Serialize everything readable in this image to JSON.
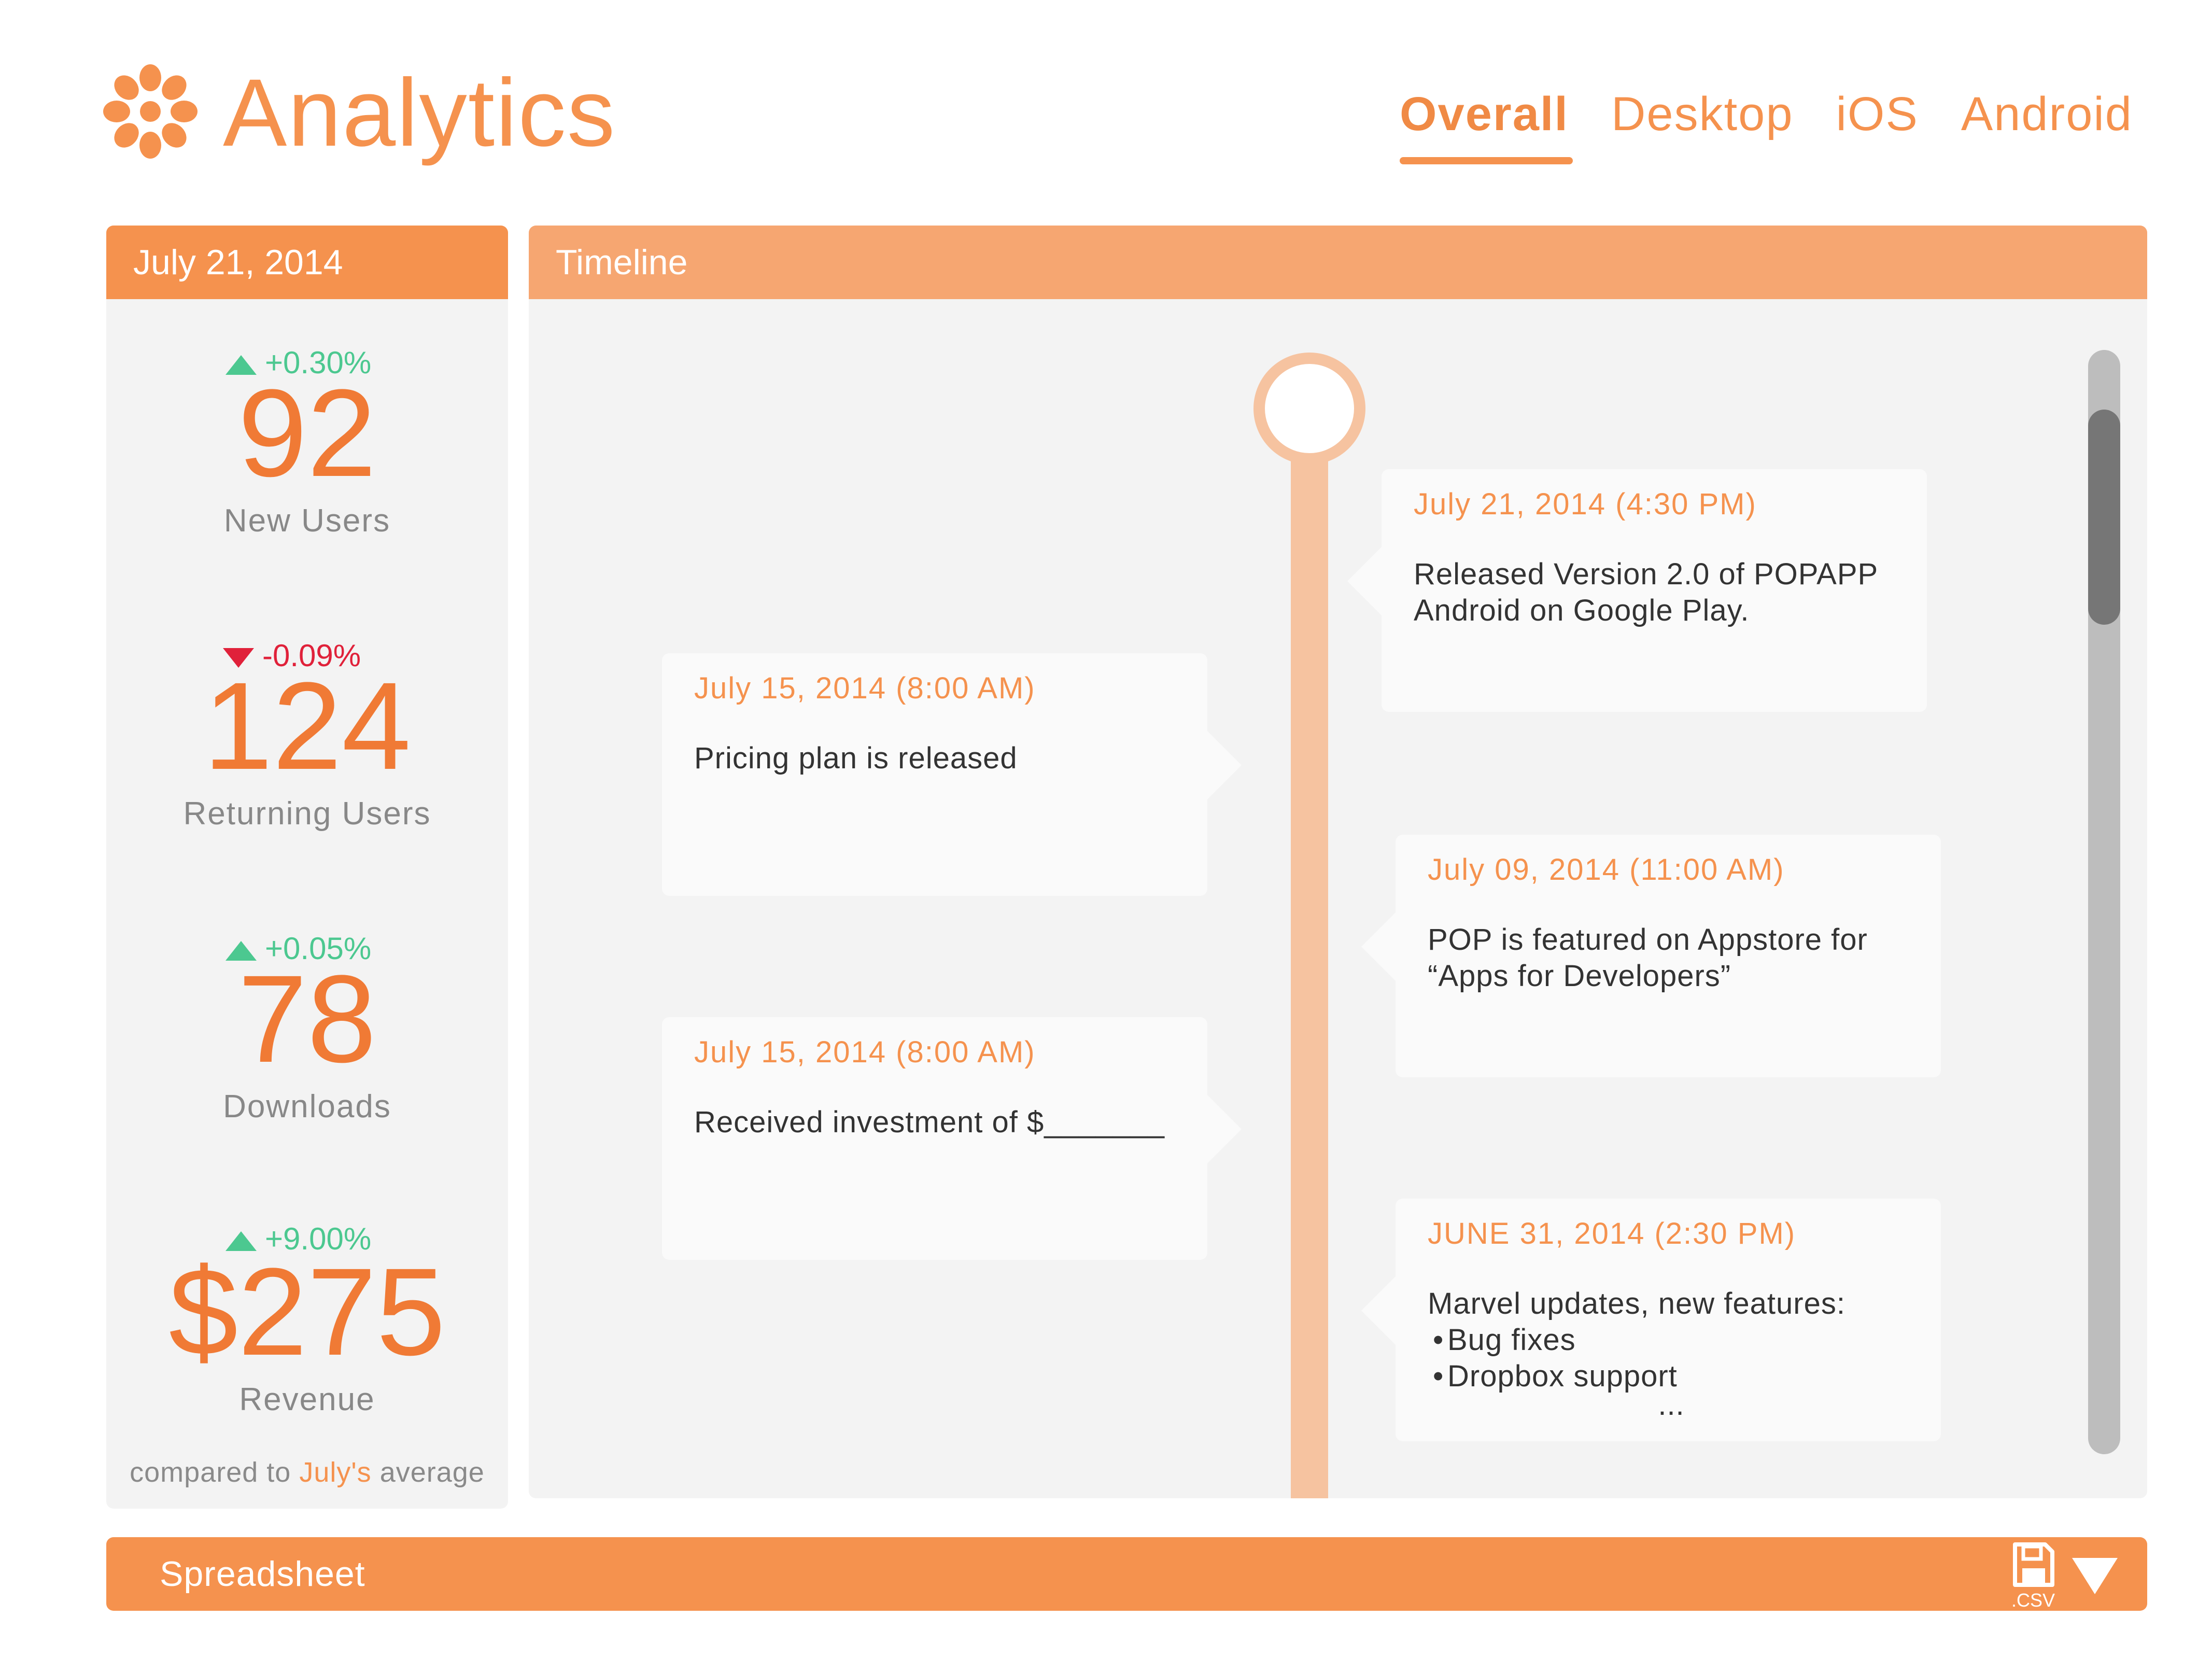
{
  "app": {
    "title": "Analytics",
    "logo_icon": "asterisk-flower-icon",
    "accent_color": "#f5924e"
  },
  "nav": {
    "tabs": [
      {
        "label": "Overall",
        "active": true
      },
      {
        "label": "Desktop",
        "active": false
      },
      {
        "label": "iOS",
        "active": false
      },
      {
        "label": "Android",
        "active": false
      }
    ]
  },
  "stats": {
    "date": "July 21, 2014",
    "items": [
      {
        "value": "92",
        "label": "New Users",
        "change": "+0.30%",
        "direction": "up"
      },
      {
        "value": "124",
        "label": "Returning Users",
        "change": "-0.09%",
        "direction": "down"
      },
      {
        "value": "78",
        "label": "Downloads",
        "change": "+0.05%",
        "direction": "up"
      },
      {
        "value": "$275",
        "label": "Revenue",
        "change": "+9.00%",
        "direction": "up"
      }
    ],
    "compare_prefix": "compared to",
    "compare_month": "July's",
    "compare_suffix": "average",
    "up_color": "#4cc890",
    "down_color": "#e0213a"
  },
  "timeline": {
    "title": "Timeline",
    "events": [
      {
        "side": "right",
        "date": "July 21, 2014 (4:30 PM)",
        "lines": [
          "Released Version 2.0 of POPAPP",
          "Android on Google Play."
        ]
      },
      {
        "side": "left",
        "date": "July 15, 2014 (8:00 AM)",
        "lines": [
          "Pricing plan is released"
        ]
      },
      {
        "side": "right",
        "date": "July 09, 2014 (11:00 AM)",
        "lines": [
          "POP is featured on Appstore for",
          "“Apps for Developers”"
        ]
      },
      {
        "side": "left",
        "date": "July 15, 2014 (8:00 AM)",
        "lines": [
          "Received investment of $_______"
        ]
      },
      {
        "side": "right",
        "date": "JUNE 31, 2014 (2:30 PM)",
        "lines": [
          "Marvel updates, new features:"
        ],
        "bullets": [
          "Bug fixes",
          "Dropbox support"
        ],
        "ellipsis": "..."
      }
    ]
  },
  "spreadsheet": {
    "label": "Spreadsheet",
    "csv_label": ".CSV",
    "save_icon": "floppy-disk-icon",
    "expand_icon": "triangle-down-icon"
  }
}
